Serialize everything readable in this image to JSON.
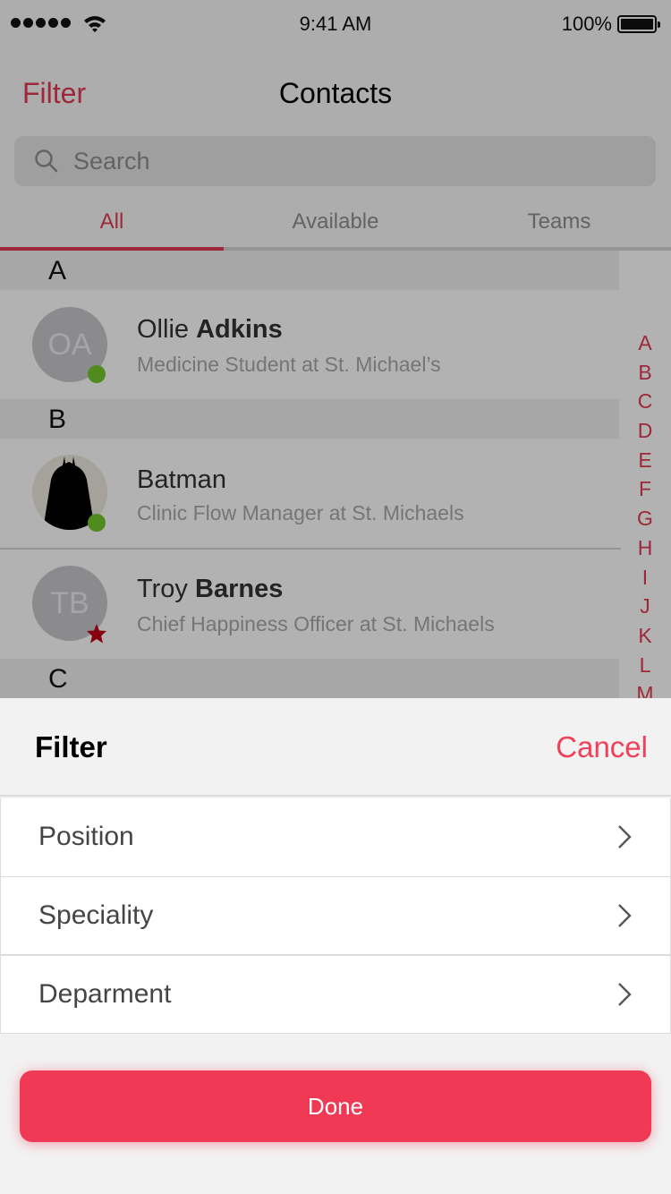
{
  "status_bar": {
    "signal_icon": "cellular-signal-icon",
    "wifi_icon": "wifi-icon",
    "time": "9:41 AM",
    "battery_percent": "100%",
    "battery_icon": "battery-full-icon"
  },
  "nav": {
    "left_button": "Filter",
    "title": "Contacts"
  },
  "search": {
    "icon": "search-icon",
    "placeholder": "Search"
  },
  "tabs": [
    {
      "label": "All",
      "active": true
    },
    {
      "label": "Available",
      "active": false
    },
    {
      "label": "Teams",
      "active": false
    }
  ],
  "contacts": {
    "sections": [
      {
        "letter": "A"
      },
      {
        "letter": "B"
      },
      {
        "letter": "C"
      }
    ],
    "rows": [
      {
        "initials": "OA",
        "first": "Ollie",
        "last": "Adkins",
        "role": "Medicine Student at St. Michael’s",
        "status": "available",
        "status_icon": "online-dot-icon"
      },
      {
        "initials": "",
        "first": "Batman",
        "last": "",
        "role": "Clinic Flow Manager at St. Michaels",
        "status": "available",
        "status_icon": "online-dot-icon",
        "avatar_icon": "batman-silhouette-icon"
      },
      {
        "initials": "TB",
        "first": "Troy",
        "last": "Barnes",
        "role": "Chief Happiness Officer at St. Michaels",
        "status": "favorite",
        "status_icon": "star-icon"
      }
    ]
  },
  "index_letters": [
    "A",
    "B",
    "C",
    "D",
    "E",
    "F",
    "G",
    "H",
    "I",
    "J",
    "K",
    "L",
    "M"
  ],
  "filter_sheet": {
    "title": "Filter",
    "cancel": "Cancel",
    "options": [
      {
        "label": "Position",
        "icon": "chevron-right-icon"
      },
      {
        "label": "Speciality",
        "icon": "chevron-right-icon"
      },
      {
        "label": "Deparment",
        "icon": "chevron-right-icon"
      }
    ],
    "done": "Done"
  },
  "colors": {
    "accent": "#e23a52",
    "done_button": "#ef3955",
    "online": "#75c72d",
    "favorite": "#c0001a"
  }
}
